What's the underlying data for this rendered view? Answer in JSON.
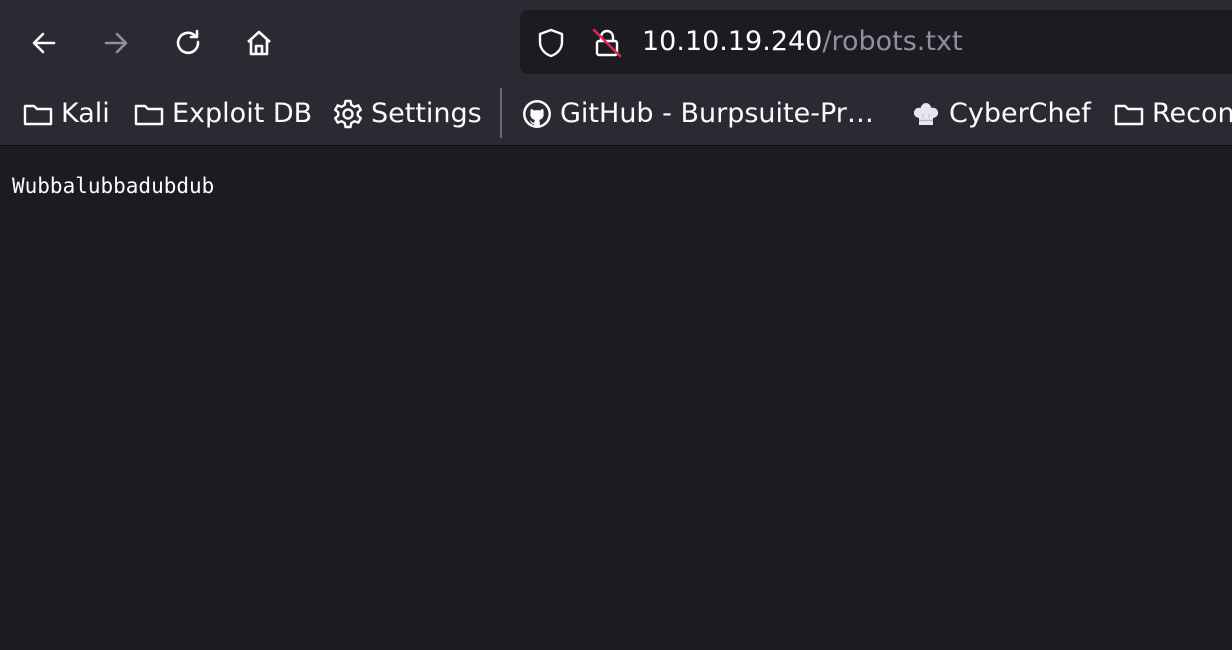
{
  "nav": {
    "back_icon": "arrow-left-icon",
    "forward_icon": "arrow-right-icon",
    "reload_icon": "reload-icon",
    "home_icon": "home-icon"
  },
  "urlbar": {
    "host": "10.10.19.240",
    "path": "/robots.txt",
    "shield_icon": "shield-icon",
    "insecure_icon": "insecure-lock-icon"
  },
  "bookmarks": {
    "items": [
      {
        "label": "Kali",
        "icon": "folder-icon"
      },
      {
        "label": "Exploit DB",
        "icon": "folder-icon"
      },
      {
        "label": "Settings",
        "icon": "gear-icon"
      },
      {
        "label": "GitHub - Burpsuite-Pr…",
        "icon": "github-icon"
      },
      {
        "label": "CyberChef",
        "icon": "chef-hat-icon"
      },
      {
        "label": "Recon",
        "icon": "folder-icon"
      }
    ]
  },
  "page": {
    "text": "Wubbalubbadubdub"
  },
  "colors": {
    "toolbar_bg": "#2b2a33",
    "content_bg": "#1c1b22",
    "text": "#fbfbfe",
    "muted_text": "#8f8f9d",
    "insecure_red": "#e22850"
  }
}
